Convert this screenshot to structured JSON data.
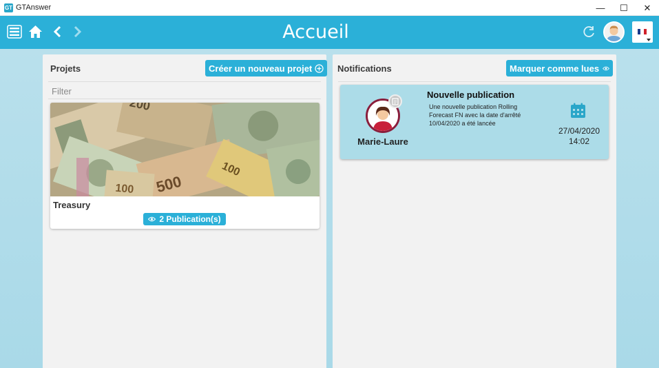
{
  "window": {
    "app_name": "GTAnswer",
    "logo_text": "GT",
    "controls": {
      "minimize": "—",
      "maximize": "☐",
      "close": "✕"
    }
  },
  "header": {
    "title": "Accueil",
    "icons": [
      "menu-icon",
      "home-icon",
      "back-icon",
      "forward-icon",
      "refresh-icon",
      "user-avatar",
      "language-flag"
    ]
  },
  "projects": {
    "heading": "Projets",
    "create_button": "Créer un nouveau projet",
    "filter_placeholder": "Filter",
    "items": [
      {
        "name": "Treasury",
        "publications": "2 Publication(s)"
      }
    ]
  },
  "notifications": {
    "heading": "Notifications",
    "mark_read_button": "Marquer comme lues",
    "items": [
      {
        "author": "Marie-Laure",
        "title": "Nouvelle publication",
        "body": "Une nouvelle publication Rolling Forecast FN avec la date d'arrêté 10/04/2020 a été lancée",
        "date": "27/04/2020",
        "time": "14:02"
      }
    ]
  },
  "colors": {
    "accent": "#2bb0d8",
    "notification_bg": "#acdce8",
    "panel_bg": "#f2f2f2"
  }
}
